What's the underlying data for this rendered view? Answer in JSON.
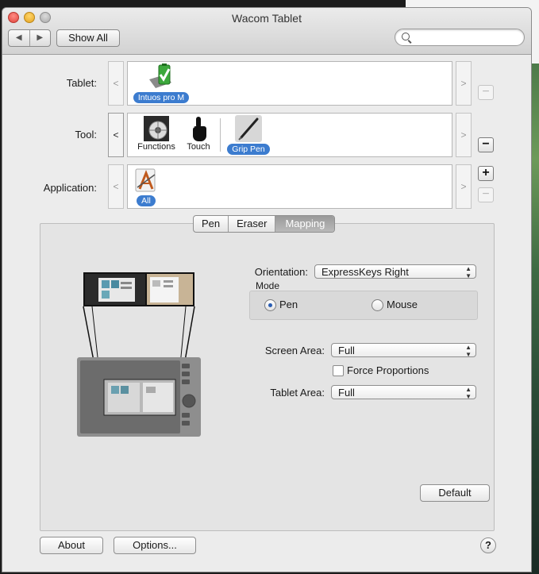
{
  "window": {
    "title": "Wacom Tablet"
  },
  "toolbar": {
    "back": "◀",
    "forward": "▶",
    "show_all": "Show All",
    "search_placeholder": ""
  },
  "tablet": {
    "label": "Tablet:",
    "device": "Intuos pro M",
    "prev": "<",
    "next": ">",
    "remove": "−"
  },
  "tool": {
    "label": "Tool:",
    "prev": "<",
    "next": ">",
    "remove": "−",
    "items": [
      {
        "label": "Functions"
      },
      {
        "label": "Touch"
      },
      {
        "label": "Grip Pen"
      }
    ]
  },
  "application": {
    "label": "Application:",
    "item": "All",
    "prev": "<",
    "next": ">",
    "add": "+",
    "remove": "−"
  },
  "tabs": {
    "items": [
      "Pen",
      "Eraser",
      "Mapping"
    ],
    "selected": "Mapping"
  },
  "mapping": {
    "orientation_label": "Orientation:",
    "orientation_value": "ExpressKeys Right",
    "mode_label": "Mode",
    "mode_options": [
      "Pen",
      "Mouse"
    ],
    "mode_selected": "Pen",
    "screen_area_label": "Screen Area:",
    "screen_area_value": "Full",
    "force_proportions_label": "Force Proportions",
    "force_proportions_checked": false,
    "tablet_area_label": "Tablet Area:",
    "tablet_area_value": "Full",
    "default_button": "Default"
  },
  "footer": {
    "about": "About",
    "options": "Options...",
    "help": "?"
  },
  "colors": {
    "accent": "#3c7ccf",
    "window_bg": "#ececec",
    "panel_bg": "#e4e4e4"
  }
}
